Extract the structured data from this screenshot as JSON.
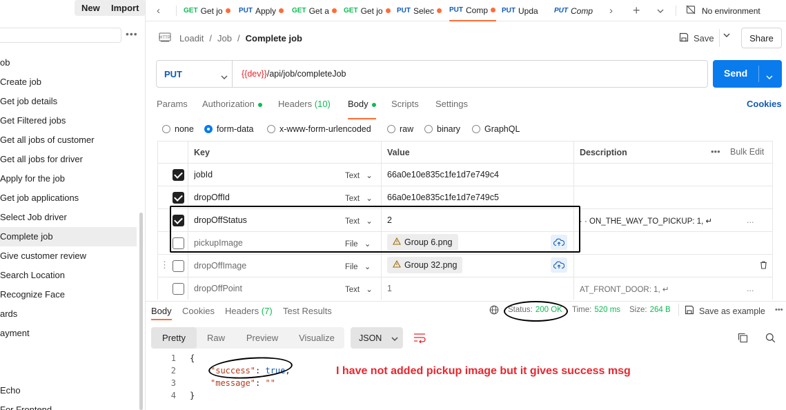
{
  "sidebar": {
    "new_label": "New",
    "import_label": "Import",
    "more_glyph": "•••",
    "items": [
      {
        "label": "ob",
        "active": false
      },
      {
        "label": "Create job",
        "active": false
      },
      {
        "label": "Get job details",
        "active": false
      },
      {
        "label": "Get Filtered jobs",
        "active": false
      },
      {
        "label": "Get all jobs of customer",
        "active": false
      },
      {
        "label": "Get all jobs for driver",
        "active": false
      },
      {
        "label": "Apply for the job",
        "active": false
      },
      {
        "label": "Get job applications",
        "active": false
      },
      {
        "label": "Select Job driver",
        "active": false
      },
      {
        "label": "Complete job",
        "active": true
      },
      {
        "label": "Give customer review",
        "active": false
      },
      {
        "label": "Search Location",
        "active": false
      },
      {
        "label": "Recognize Face",
        "active": false
      },
      {
        "label": "ards",
        "active": false
      },
      {
        "label": "ayment",
        "active": false
      },
      {
        "label": "",
        "active": false
      },
      {
        "label": " Echo",
        "active": false
      },
      {
        "label": "  For Frontend",
        "active": false
      }
    ]
  },
  "tabs": [
    {
      "method": "GET",
      "name": "Get jo",
      "dot": true
    },
    {
      "method": "PUT",
      "name": "Apply",
      "dot": true
    },
    {
      "method": "GET",
      "name": "Get a",
      "dot": true
    },
    {
      "method": "GET",
      "name": "Get jo",
      "dot": true
    },
    {
      "method": "PUT",
      "name": "Selec",
      "dot": true
    },
    {
      "method": "PUT",
      "name": "Comp",
      "dot": true,
      "active": true
    },
    {
      "method": "PUT",
      "name": "Upda",
      "dot": false
    },
    {
      "method": "PUT",
      "name": "Comp",
      "dot": false,
      "italic": true
    }
  ],
  "environment": "No environment",
  "breadcrumb": {
    "seg1": "Loadit",
    "sep1": "/",
    "seg2": "Job",
    "sep2": "/",
    "current": "Complete job"
  },
  "actions": {
    "save": "Save",
    "share": "Share"
  },
  "request": {
    "method": "PUT",
    "url_var": "{{dev}}",
    "url_path": "/api/job/completeJob",
    "send": "Send"
  },
  "request_tabs": {
    "params": "Params",
    "authorization": "Authorization",
    "headers": "Headers",
    "headers_count": "(10)",
    "body": "Body",
    "scripts": "Scripts",
    "settings": "Settings",
    "cookies": "Cookies"
  },
  "body_types": [
    "none",
    "form-data",
    "x-www-form-urlencoded",
    "raw",
    "binary",
    "GraphQL"
  ],
  "body_type_selected": "form-data",
  "table": {
    "headers": {
      "key": "Key",
      "value": "Value",
      "description": "Description",
      "bulk_edit": "Bulk Edit",
      "more": "•••"
    },
    "rows": [
      {
        "checked": true,
        "key": "jobId",
        "type": "Text",
        "value": "66a0e10e835c1fe1d7e749c4",
        "description": "",
        "is_file": false
      },
      {
        "checked": true,
        "key": "dropOffId",
        "type": "Text",
        "value": "66a0e10e835c1fe1d7e749c5",
        "description": "",
        "is_file": false
      },
      {
        "checked": true,
        "key": "dropOffStatus",
        "type": "Text",
        "value": "2",
        "description": "· · ON_THE_WAY_TO_PICKUP: 1, ↵",
        "is_file": false,
        "more": "..."
      },
      {
        "checked": false,
        "key": "pickupImage",
        "type": "File",
        "value": "Group 6.png",
        "description": "",
        "is_file": true
      },
      {
        "checked": false,
        "key": "dropOffImage",
        "type": "File",
        "value": "Group 32.png",
        "description": "",
        "is_file": true
      },
      {
        "checked": false,
        "key": "dropOffPoint",
        "type": "Text",
        "value": "1",
        "description": "AT_FRONT_DOOR: 1, ↵",
        "is_file": false,
        "more": "..."
      }
    ]
  },
  "response": {
    "tabs": {
      "body": "Body",
      "cookies": "Cookies",
      "headers": "Headers",
      "headers_count": "(7)",
      "tests": "Test Results"
    },
    "status_label": "Status:",
    "status_value": "200 OK",
    "time_label": "Time:",
    "time_value": "520 ms",
    "size_label": "Size:",
    "size_value": "264 B",
    "save_example": "Save as example",
    "more": "•••",
    "view_tabs": [
      "Pretty",
      "Raw",
      "Preview",
      "Visualize"
    ],
    "format": "JSON",
    "lines": [
      {
        "n": "1",
        "text": "{"
      },
      {
        "n": "2",
        "key": "\"success\"",
        "sep": ": ",
        "val": "true",
        "tail": ","
      },
      {
        "n": "3",
        "key": "\"message\"",
        "sep": ": ",
        "val": "\"\"",
        "tail": ""
      },
      {
        "n": "4",
        "text": "}"
      }
    ]
  },
  "annotation_note": "I have not added pickup image but it gives success msg",
  "colors": {
    "accent": "#ff6c37",
    "send": "#097bed",
    "put": "#0f5bb5",
    "get": "#0cbb52",
    "status_ok": "#0cbb52",
    "annotation": "#e8262e"
  }
}
